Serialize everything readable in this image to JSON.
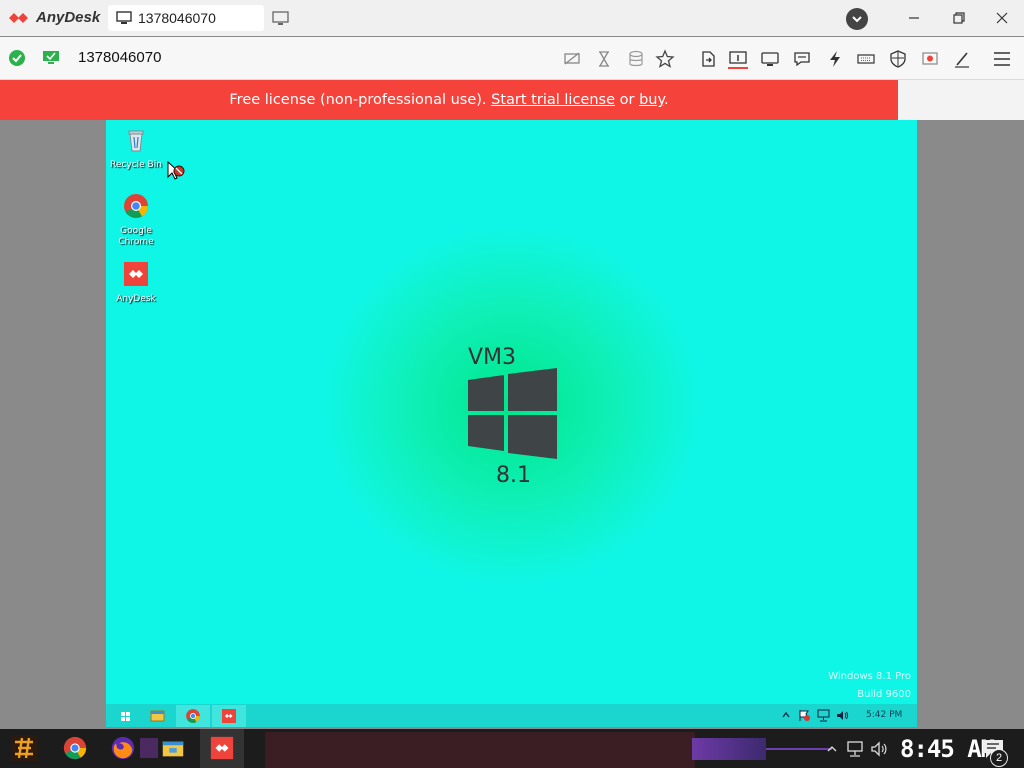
{
  "app": {
    "name": "AnyDesk",
    "tab_label": "1378046070",
    "address": "1378046070"
  },
  "banner": {
    "prefix": "Free license (non-professional use). ",
    "trial_link": "Start trial license",
    "middle": " or ",
    "buy_link": "buy",
    "suffix": "."
  },
  "colors": {
    "banner": "#f5423a",
    "remote_bg": "#10f6e6",
    "remote_glow": "#00e68a",
    "anydesk_red": "#ef443b"
  },
  "remote": {
    "desktop_icons": [
      {
        "label": "Recycle Bin",
        "icon": "recycle-bin-icon"
      },
      {
        "label": "Google Chrome",
        "icon": "chrome-icon"
      },
      {
        "label": "AnyDesk",
        "icon": "anydesk-icon"
      }
    ],
    "vm_name": "VM3",
    "os_version": "8.1",
    "watermark_line1": "Windows 8.1 Pro",
    "watermark_line2": "Build 9600",
    "clock": "5:42 PM"
  },
  "local_taskbar": {
    "clock": "8:45 AM",
    "notification_count": "2"
  }
}
